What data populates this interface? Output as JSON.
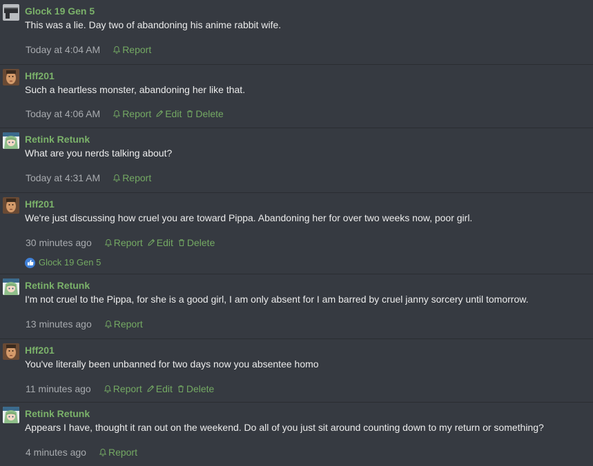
{
  "posts": [
    {
      "username": "Glock 19 Gen 5",
      "avatar": "gun-avatar",
      "text": "This was a lie. Day two of abandoning his anime rabbit wife.",
      "time": "Today at 4:04 AM",
      "actions": [
        "Report"
      ]
    },
    {
      "username": "Hff201",
      "avatar": "face-avatar",
      "text": "Such a heartless monster, abandoning her like that.",
      "time": "Today at 4:06 AM",
      "actions": [
        "Report",
        "Edit",
        "Delete"
      ]
    },
    {
      "username": "Retink Retunk",
      "avatar": "anime-avatar",
      "text": "What are you nerds talking about?",
      "time": "Today at 4:31 AM",
      "actions": [
        "Report"
      ]
    },
    {
      "username": "Hff201",
      "avatar": "face-avatar",
      "text": "We're just discussing how cruel you are toward Pippa. Abandoning her for over two weeks now, poor girl.",
      "time": "30 minutes ago",
      "actions": [
        "Report",
        "Edit",
        "Delete"
      ],
      "reaction": "Glock 19 Gen 5"
    },
    {
      "username": "Retink Retunk",
      "avatar": "anime-avatar",
      "text": "I'm not cruel to the Pippa, for she is a good girl, I am only absent for I am barred by cruel janny sorcery until tomorrow.",
      "time": "13 minutes ago",
      "actions": [
        "Report"
      ]
    },
    {
      "username": "Hff201",
      "avatar": "face-avatar",
      "text": "You've literally been unbanned for two days now you absentee homo",
      "time": "11 minutes ago",
      "actions": [
        "Report",
        "Edit",
        "Delete"
      ]
    },
    {
      "username": "Retink Retunk",
      "avatar": "anime-avatar",
      "text": "Appears I have, thought it ran out on the weekend. Do all of you just sit around counting down to my return or something?",
      "time": "4 minutes ago",
      "actions": [
        "Report"
      ]
    }
  ],
  "colors": {
    "background": "#363a41",
    "username": "#7bb26a",
    "action": "#74a963",
    "timestamp": "#a8abaf",
    "like": "#3f7fd6"
  },
  "icons": {
    "report": "bell-icon",
    "edit": "pencil-icon",
    "delete": "trash-icon",
    "like": "thumbs-up-icon"
  }
}
